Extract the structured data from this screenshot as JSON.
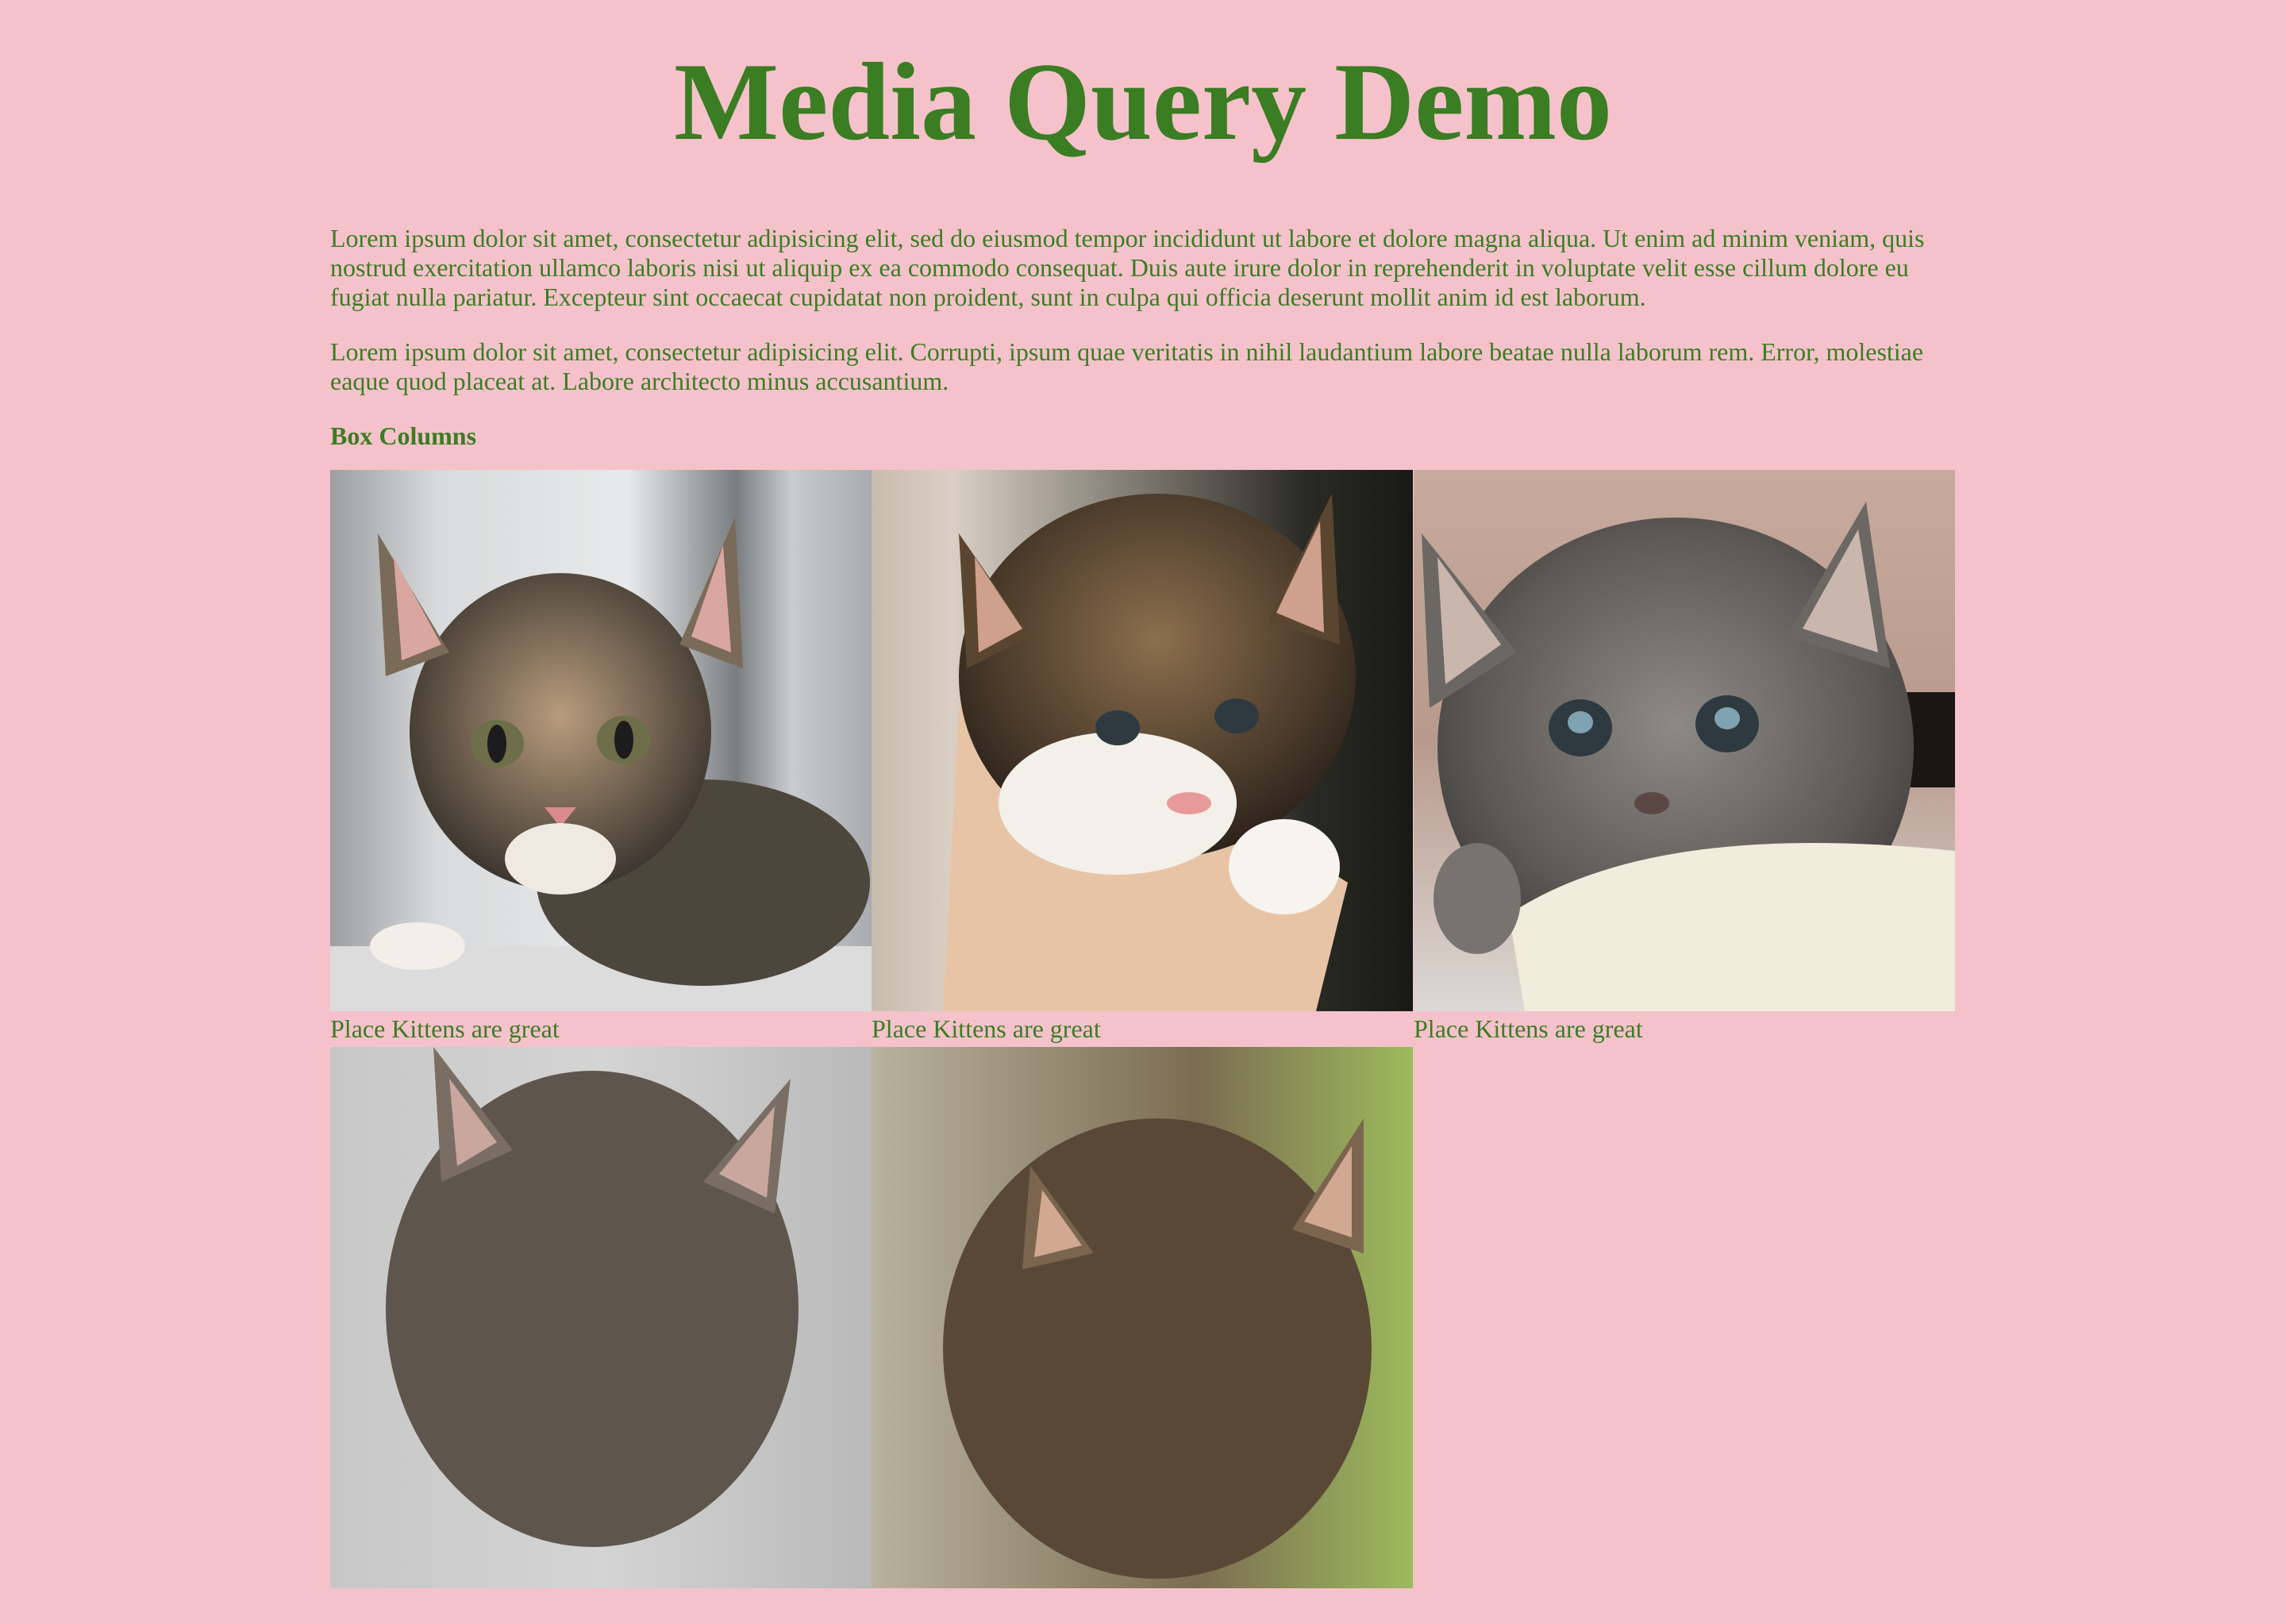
{
  "page": {
    "title": "Media Query Demo",
    "paragraphs": [
      "Lorem ipsum dolor sit amet, consectetur adipisicing elit, sed do eiusmod tempor incididunt ut labore et dolore magna aliqua. Ut enim ad minim veniam, quis nostrud exercitation ullamco laboris nisi ut aliquip ex ea commodo consequat. Duis aute irure dolor in reprehenderit in voluptate velit esse cillum dolore eu fugiat nulla pariatur. Excepteur sint occaecat cupidatat non proident, sunt in culpa qui officia deserunt mollit anim id est laborum.",
      "Lorem ipsum dolor sit amet, consectetur adipisicing elit. Corrupti, ipsum quae veritatis in nihil laudantium labore beatae nulla laborum rem. Error, molestiae eaque quod placeat at. Labore architecto minus accusantium."
    ],
    "section_heading": "Box Columns"
  },
  "cards": [
    {
      "image": "kitten-photo",
      "caption": "Place Kittens are great"
    },
    {
      "image": "kitten-photo",
      "caption": "Place Kittens are great"
    },
    {
      "image": "kitten-photo",
      "caption": "Place Kittens are great"
    },
    {
      "image": "kitten-photo",
      "caption": ""
    },
    {
      "image": "kitten-photo",
      "caption": ""
    }
  ],
  "colors": {
    "background": "#f5c2cb",
    "text": "#3a7d22"
  }
}
